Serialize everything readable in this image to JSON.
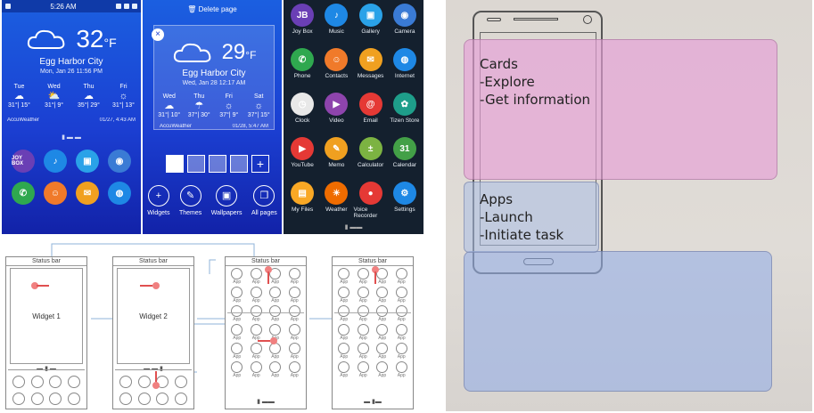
{
  "screen1": {
    "status": {
      "time": "5:26 AM"
    },
    "weather": {
      "temp": "32",
      "unit": "°F",
      "city": "Egg Harbor City",
      "date": "Mon, Jan 26 11:56 PM",
      "forecast": [
        {
          "day": "Tue",
          "icon": "cloud-icon",
          "range": "31°| 15°"
        },
        {
          "day": "Wed",
          "icon": "partly-cloudy-icon",
          "range": "31°| 9°"
        },
        {
          "day": "Thu",
          "icon": "cloud-icon",
          "range": "35°| 29°"
        },
        {
          "day": "Fri",
          "icon": "sun-icon",
          "range": "31°| 13°"
        }
      ],
      "provider": "AccuWeather",
      "updated": "01/27, 4:43 AM"
    },
    "dock": [
      {
        "label": "JOY BOX",
        "color": "#6a3fb5"
      },
      {
        "label": "♪",
        "color": "#1e88e5"
      },
      {
        "label": "▣",
        "color": "#2aa2e8"
      },
      {
        "label": "◉",
        "color": "#3a7bd5"
      },
      {
        "label": "✆",
        "color": "#2fa84f"
      },
      {
        "label": "☺",
        "color": "#f07a2a"
      },
      {
        "label": "✉",
        "color": "#f0a020"
      },
      {
        "label": "◍",
        "color": "#1e88e5"
      }
    ]
  },
  "screen2": {
    "delete_page": "Delete page",
    "weather": {
      "temp": "29",
      "unit": "°F",
      "city": "Egg Harbor City",
      "date": "Wed, Jan 28 12:17 AM",
      "forecast": [
        {
          "day": "Wed",
          "range": "31°| 10°"
        },
        {
          "day": "Thu",
          "range": "37°| 30°"
        },
        {
          "day": "Fri",
          "range": "37°| 9°"
        },
        {
          "day": "Sat",
          "range": "37°| 15°"
        }
      ],
      "provider": "AccuWeather",
      "updated": "01/28, 5:47 AM"
    },
    "tools": [
      {
        "label": "Widgets",
        "glyph": "+"
      },
      {
        "label": "Themes",
        "glyph": "✎"
      },
      {
        "label": "Wallpapers",
        "glyph": "▣"
      },
      {
        "label": "All pages",
        "glyph": "❐"
      }
    ]
  },
  "screen3": {
    "apps": [
      {
        "label": "Joy Box",
        "glyph": "JB",
        "color": "#6a3fb5"
      },
      {
        "label": "Music",
        "glyph": "♪",
        "color": "#1e88e5"
      },
      {
        "label": "Gallery",
        "glyph": "▣",
        "color": "#2aa2e8"
      },
      {
        "label": "Camera",
        "glyph": "◉",
        "color": "#3a7bd5"
      },
      {
        "label": "Phone",
        "glyph": "✆",
        "color": "#2fa84f"
      },
      {
        "label": "Contacts",
        "glyph": "☺",
        "color": "#f07a2a"
      },
      {
        "label": "Messages",
        "glyph": "✉",
        "color": "#f0a020"
      },
      {
        "label": "Internet",
        "glyph": "◍",
        "color": "#1e88e5"
      },
      {
        "label": "Clock",
        "glyph": "◷",
        "color": "#e8e8e8"
      },
      {
        "label": "Video",
        "glyph": "▶",
        "color": "#8e44ad"
      },
      {
        "label": "Email",
        "glyph": "@",
        "color": "#e53935"
      },
      {
        "label": "Tizen Store",
        "glyph": "✿",
        "color": "#1e9e8a"
      },
      {
        "label": "YouTube",
        "glyph": "▶",
        "color": "#e53935"
      },
      {
        "label": "Memo",
        "glyph": "✎",
        "color": "#f0a020"
      },
      {
        "label": "Calculator",
        "glyph": "±",
        "color": "#7cb342"
      },
      {
        "label": "Calendar",
        "glyph": "31",
        "color": "#43a047"
      },
      {
        "label": "My Files",
        "glyph": "▤",
        "color": "#f9a825"
      },
      {
        "label": "Weather",
        "glyph": "☀",
        "color": "#ef6c00"
      },
      {
        "label": "Voice Recorder",
        "glyph": "●",
        "color": "#e53935"
      },
      {
        "label": "Settings",
        "glyph": "⚙",
        "color": "#1e88e5"
      }
    ]
  },
  "wireframe": {
    "status_label": "Status bar",
    "widget1": "Widget 1",
    "widget2": "Widget 2",
    "app_label": "App"
  },
  "whiteboard": {
    "cards": [
      "Cards",
      "-Explore",
      "-Get information"
    ],
    "apps": [
      "Apps",
      "-Launch",
      "-Initiate task"
    ]
  }
}
